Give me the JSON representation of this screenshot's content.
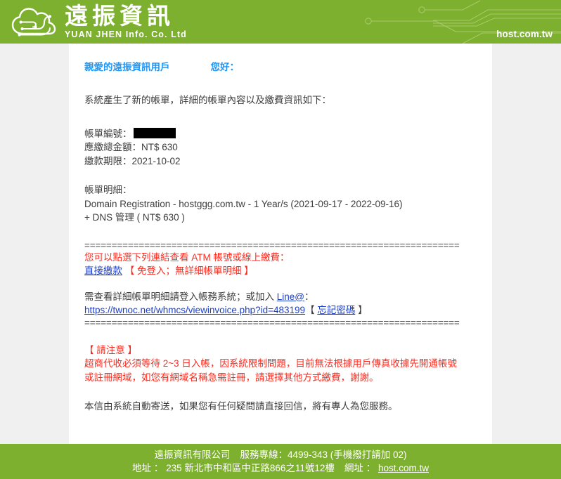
{
  "header": {
    "logo_cn": "遠振資訊",
    "logo_en": "YUAN JHEN Info. Co. Ltd",
    "logo_icon": "cloud-circuit-logo",
    "site": "host.com.tw",
    "brand_green": "#7db02e"
  },
  "mail": {
    "greeting_name": "親愛的遠振資訊用戶",
    "greeting_hello": "您好：",
    "intro": "系統產生了新的帳單，詳細的帳單內容以及繳費資訊如下：",
    "invoice_no_label": "帳單編號：",
    "invoice_no_value": "",
    "amount_line": "應繳總金額：NT$ 630",
    "due_line": "繳款期限：2021-10-02",
    "detail_label": "帳單明細：",
    "detail_line1": "Domain Registration - hostggg.com.tw - 1 Year/s (2021-09-17 - 2022-09-16)",
    "detail_line2": "+ DNS 管理   ( NT$ 630 )",
    "separator": "=====================================================================",
    "atm_notice": "您可以點選下列連結查看 ATM 帳號或線上繳費：",
    "pay_link_text": "直接繳款",
    "pay_link_note": "【 免登入；無詳細帳單明細 】",
    "login_notice_pre": "需查看詳細帳單明細請登入帳務系統；或加入 ",
    "line_link_text": "Line@",
    "login_notice_post": "：",
    "invoice_url": "https://twnoc.net/whmcs/viewinvoice.php?id=483199",
    "forgot_open": "【 ",
    "forgot_link_text": "忘記密碼",
    "forgot_close": " 】",
    "attention_title": "【 請注意 】",
    "attention_line1": "超商代收必須等待 2~3 日入帳，因系統限制問題，目前無法根據用戶傳真收據先開通帳號",
    "attention_line2": "或註冊網域，如您有網域名稱急需註冊，請選擇其他方式繳費，謝謝。",
    "closing": "本信由系統自動寄送，如果您有任何疑問請直接回信，將有專人為您服務。",
    "link_color": "#1a3ecb",
    "red_color": "#fb2a1e",
    "greeting_color": "#2196f3"
  },
  "footer": {
    "company": "遠振資訊有限公司",
    "hotline": "服務專線：4499-343 (手機撥打請加 02)",
    "address_label": "地址 ：",
    "address": "235 新北市中和區中正路866之11號12樓",
    "website_label": "網址 ：",
    "website": "host.com.tw"
  }
}
